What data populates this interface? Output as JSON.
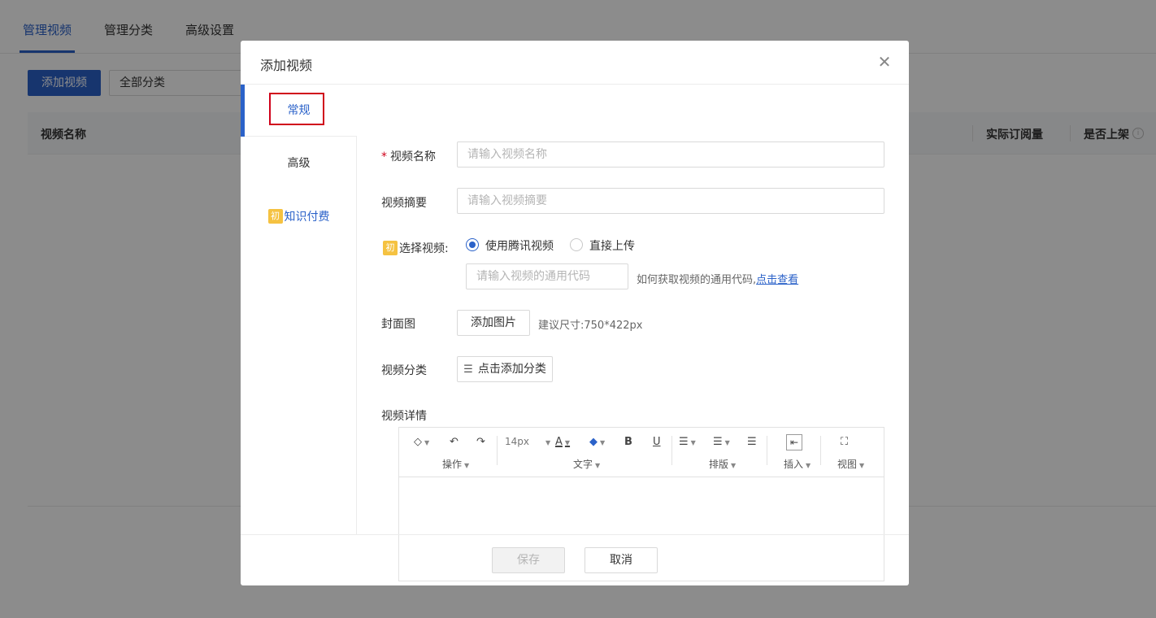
{
  "page": {
    "tabs": [
      "管理视频",
      "管理分类",
      "高级设置"
    ],
    "add_button": "添加视频",
    "category_select": "全部分类",
    "table_headers": [
      "视频名称",
      "实际订阅量",
      "是否上架"
    ]
  },
  "modal": {
    "title": "添加视频",
    "close_glyph": "✕",
    "nav": {
      "general": "常规",
      "advanced": "高级",
      "badge": "初",
      "paid": "知识付费"
    },
    "form": {
      "required_mark": "*",
      "name_label": "视频名称",
      "name_placeholder": "请输入视频名称",
      "summary_label": "视频摘要",
      "summary_placeholder": "请输入视频摘要",
      "select_video_label": "选择视频:",
      "radio_tencent": "使用腾讯视频",
      "radio_upload": "直接上传",
      "code_placeholder": "请输入视频的通用代码",
      "code_hint": "如何获取视频的通用代码,",
      "code_hint_link": "点击查看",
      "cover_label": "封面图",
      "add_image_button": "添加图片",
      "size_hint": "建议尺寸:750*422px",
      "category_label": "视频分类",
      "add_category_button": "点击添加分类",
      "detail_label": "视频详情"
    },
    "editor_toolbar": {
      "font_size": "14px",
      "groups": [
        "操作",
        "文字",
        "排版",
        "插入",
        "视图"
      ]
    },
    "footer": {
      "save": "保存",
      "cancel": "取消"
    }
  }
}
